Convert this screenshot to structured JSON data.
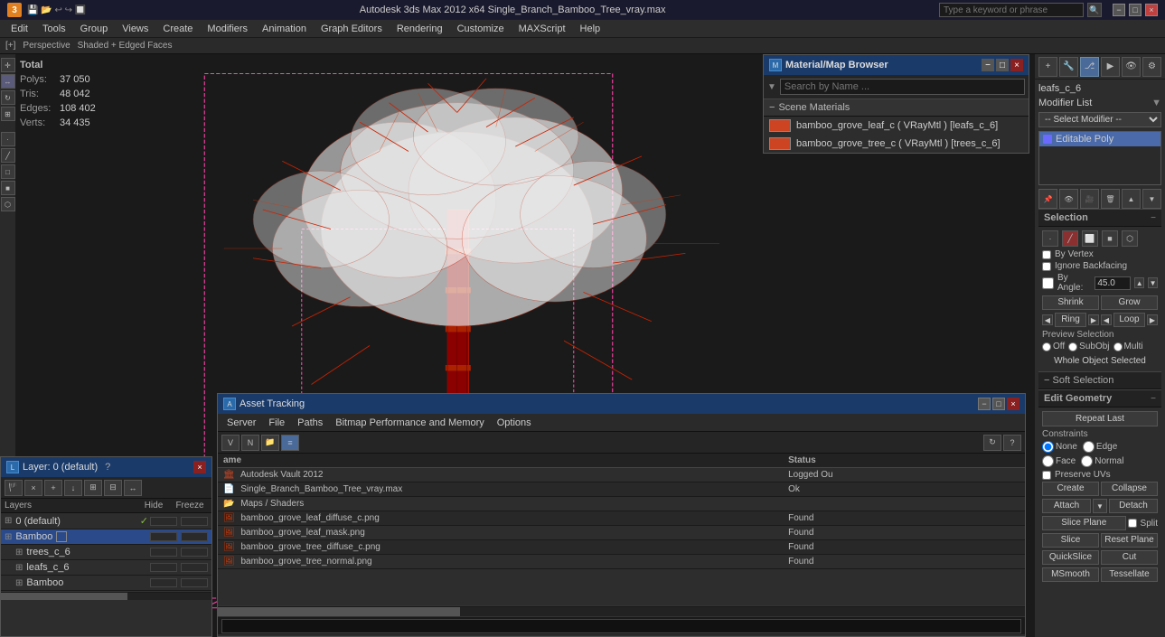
{
  "titlebar": {
    "title": "Autodesk 3ds Max 2012 x64     Single_Branch_Bamboo_Tree_vray.max",
    "search_placeholder": "Type a keyword or phrase",
    "min_label": "−",
    "max_label": "□",
    "close_label": "×"
  },
  "menubar": {
    "items": [
      "Edit",
      "Tools",
      "Group",
      "Views",
      "Create",
      "Modifiers",
      "Animation",
      "Graph Editors",
      "Rendering",
      "Customize",
      "MAXScript",
      "Help"
    ]
  },
  "viewport_info": {
    "nav_label": "[+]",
    "view_label": "Perspective",
    "mode_label": "Shaded + Edged Faces"
  },
  "stats": {
    "header": "Total",
    "polys_label": "Polys:",
    "polys_value": "37 050",
    "tris_label": "Tris:",
    "tris_value": "48 042",
    "edges_label": "Edges:",
    "edges_value": "108 402",
    "verts_label": "Verts:",
    "verts_value": "34 435"
  },
  "object_name": "leafs_c_6",
  "modifier_list_label": "Modifier List",
  "modifier_item": "Editable Poly",
  "selection": {
    "title": "Selection",
    "by_vertex": "By Vertex",
    "ignore_backfacing": "Ignore Backfacing",
    "by_angle": "By Angle:",
    "angle_value": "45.0",
    "shrink": "Shrink",
    "grow": "Grow",
    "ring": "Ring",
    "loop": "Loop",
    "preview_selection": "Preview Selection",
    "off": "Off",
    "subobj": "SubObj",
    "multi": "Multi",
    "whole_object": "Whole Object Selected"
  },
  "soft_selection": {
    "title": "Soft Selection"
  },
  "edit_geometry": {
    "title": "Edit Geometry",
    "repeat_last": "Repeat Last",
    "constraints_label": "Constraints",
    "none": "None",
    "edge": "Edge",
    "face": "Face",
    "normal": "Normal",
    "preserve_uvs": "Preserve UVs",
    "create": "Create",
    "collapse": "Collapse",
    "attach": "Attach",
    "detach": "Detach",
    "slice_plane": "Slice Plane",
    "split": "Split",
    "slice": "Slice",
    "reset_plane": "Reset Plane",
    "quickslice": "QuickSlice",
    "cut": "Cut",
    "msmooth": "MSmooth",
    "tessellate": "Tessellate"
  },
  "material_browser": {
    "title": "Material/Map Browser",
    "search_placeholder": "Search by Name ...",
    "scene_materials": "Scene Materials",
    "materials": [
      {
        "name": "bamboo_grove_leaf_c ( VRayMtl ) [leafs_c_6]"
      },
      {
        "name": "bamboo_grove_tree_c ( VRayMtl ) [trees_c_6]"
      }
    ]
  },
  "asset_tracking": {
    "title": "Asset Tracking",
    "menus": [
      "Server",
      "File",
      "Paths",
      "Bitmap Performance and Memory",
      "Options"
    ],
    "columns": [
      "ame",
      "Status"
    ],
    "rows": [
      {
        "icon": "vault",
        "name": "Autodesk Vault 2012",
        "status": "Logged Ou"
      },
      {
        "icon": "file",
        "name": "Single_Branch_Bamboo_Tree_vray.max",
        "status": "Ok"
      },
      {
        "icon": "folder",
        "name": "Maps / Shaders",
        "status": ""
      },
      {
        "icon": "image",
        "name": "bamboo_grove_leaf_diffuse_c.png",
        "status": "Found"
      },
      {
        "icon": "image",
        "name": "bamboo_grove_leaf_mask.png",
        "status": "Found"
      },
      {
        "icon": "image",
        "name": "bamboo_grove_tree_diffuse_c.png",
        "status": "Found"
      },
      {
        "icon": "image",
        "name": "bamboo_grove_tree_normal.png",
        "status": "Found"
      }
    ]
  },
  "layers": {
    "title": "Layer: 0 (default)",
    "header": {
      "name": "Layers",
      "hide": "Hide",
      "freeze": "Freeze"
    },
    "items": [
      {
        "name": "0 (default)",
        "level": 0,
        "checked": true
      },
      {
        "name": "Bamboo",
        "level": 0,
        "selected": true,
        "has_box": true
      },
      {
        "name": "trees_c_6",
        "level": 1
      },
      {
        "name": "leafs_c_6",
        "level": 1
      },
      {
        "name": "Bamboo",
        "level": 1
      }
    ]
  },
  "icons": {
    "close": "×",
    "minimize": "−",
    "maximize": "□",
    "collapse": "−",
    "expand": "+",
    "search": "🔍",
    "check": "✓",
    "arrow_down": "▼",
    "arrow_right": "▶"
  }
}
